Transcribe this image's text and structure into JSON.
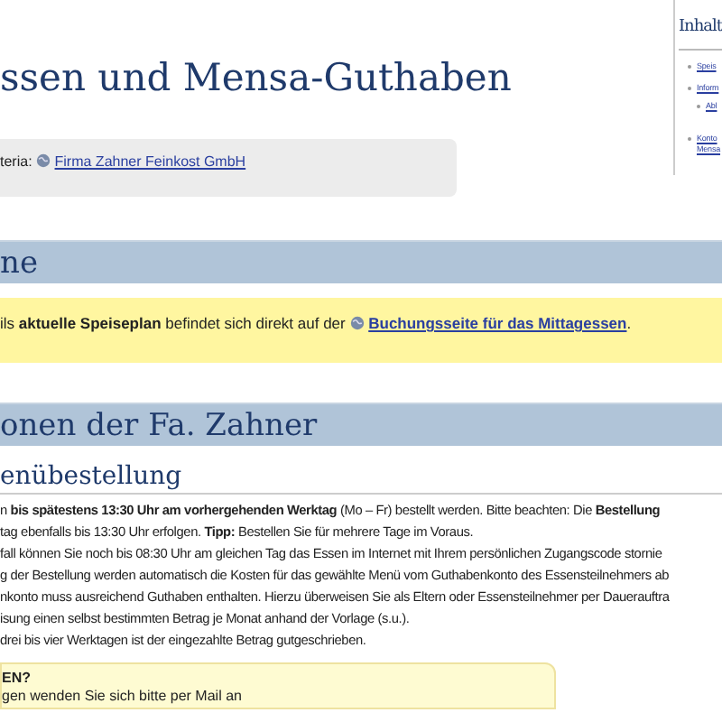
{
  "title": "ssen und Mensa-Guthaben",
  "caterer": {
    "label": "teria:",
    "link": "Firma Zahner Feinkost GmbH"
  },
  "toc": {
    "title": "Inhalt",
    "items": [
      {
        "label": "Speis"
      },
      {
        "label": "Inform",
        "children": [
          {
            "label": "Abl"
          }
        ]
      },
      {
        "label": "Konto Mensa"
      }
    ]
  },
  "sections": [
    {
      "heading": "ne",
      "notice": {
        "text": "ils **aktuelle Speiseplan** befindet sich direkt auf der",
        "link": "Buchungsseite für das Mittagessen",
        "after": "."
      }
    },
    {
      "heading": "onen der Fa. Zahner",
      "subheading": "enübestellung",
      "lines": [
        "n **bis spätestens 13:30 Uhr am vorhergehenden Werktag** (Mo – Fr) bestellt werden. Bitte beachten: Die **Bestellung**",
        "tag ebenfalls bis 13:30 Uhr erfolgen. **Tipp:** Bestellen Sie für mehrere Tage im Voraus.",
        "fall können Sie noch bis 08:30 Uhr am gleichen Tag das Essen im Internet mit Ihrem persönlichen Zugangscode stornie",
        "g der Bestellung werden automatisch die Kosten für das gewählte Menü vom Guthabenkonto des Essensteilnehmers ab",
        "nkonto muss ausreichend Guthaben enthalten. Hierzu überweisen Sie als Eltern oder Essensteilnehmer per Dauerauftra",
        "isung einen selbst bestimmten Betrag je Monat anhand der Vorlage (s.u.).",
        "drei bis vier Werktagen ist der eingezahlte Betrag gutgeschrieben."
      ],
      "box": {
        "title": "EN?",
        "text": "gen wenden Sie sich bitte per Mail an"
      }
    }
  ]
}
